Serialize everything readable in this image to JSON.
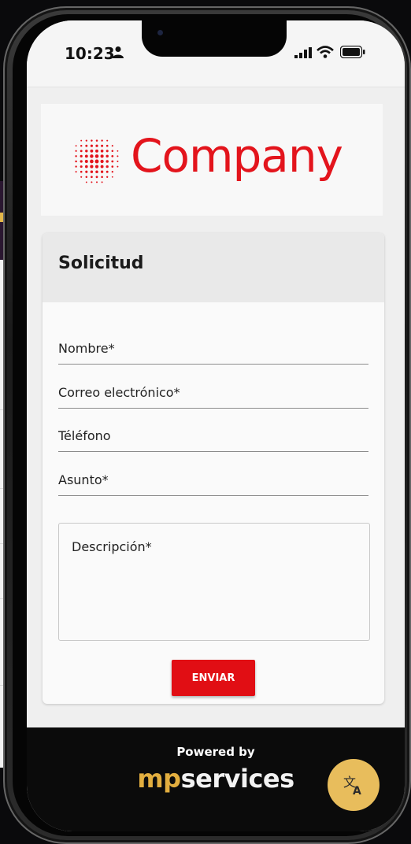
{
  "status_bar": {
    "time": "10:23",
    "icons": [
      "person-icon",
      "signal-icon",
      "wifi-icon",
      "battery-icon"
    ]
  },
  "logo": {
    "text": "Company",
    "color": "#e3141c"
  },
  "form": {
    "title": "Solicitud",
    "fields": {
      "nombre": "Nombre*",
      "correo": "Correo electrónico*",
      "telefono": "Téléfono",
      "asunto": "Asunto*",
      "descripcion": "Descripción*"
    },
    "submit_label": "ENVIAR",
    "accent_color": "#e10e14"
  },
  "footer": {
    "powered_by": "Powered by",
    "brand_prefix": "mp",
    "brand_suffix": "services",
    "brand_color": "#e2ae3f",
    "translate_icon": "translate-icon"
  }
}
